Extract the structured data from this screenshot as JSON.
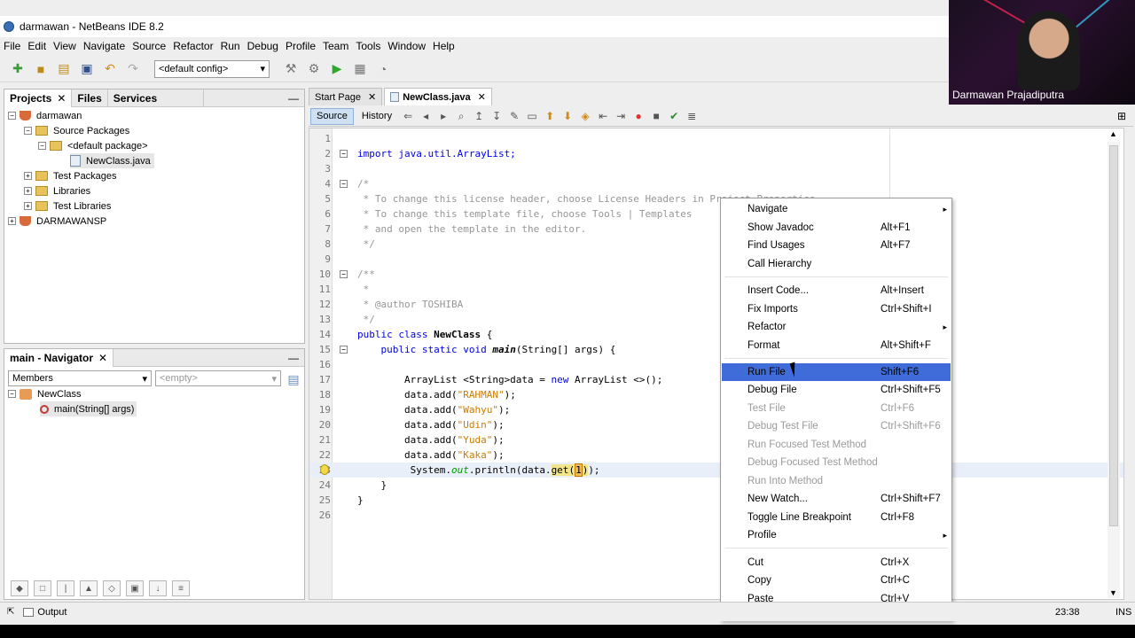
{
  "window": {
    "title": "darmawan - NetBeans IDE 8.2"
  },
  "menubar": [
    "File",
    "Edit",
    "View",
    "Navigate",
    "Source",
    "Refactor",
    "Run",
    "Debug",
    "Profile",
    "Team",
    "Tools",
    "Window",
    "Help"
  ],
  "toolbar": {
    "config": "<default config>"
  },
  "webcam": {
    "name": "Darmawan Prajadiputra"
  },
  "projects_panel": {
    "tabs": [
      "Projects",
      "Files",
      "Services"
    ],
    "tree": [
      {
        "label": "darmawan"
      },
      {
        "label": "Source Packages"
      },
      {
        "label": "<default package>"
      },
      {
        "label": "NewClass.java"
      },
      {
        "label": "Test Packages"
      },
      {
        "label": "Libraries"
      },
      {
        "label": "Test Libraries"
      },
      {
        "label": "DARMAWANSP"
      }
    ]
  },
  "navigator": {
    "title": "main - Navigator",
    "filter": "Members",
    "filter2": "<empty>",
    "class": "NewClass",
    "method": "main(String[] args)"
  },
  "editor": {
    "tabs": [
      "Start Page",
      "NewClass.java"
    ],
    "source_label": "Source",
    "history_label": "History",
    "line_numbers": [
      "1",
      "2",
      "3",
      "4",
      "5",
      "6",
      "7",
      "8",
      "9",
      "10",
      "11",
      "12",
      "13",
      "14",
      "15",
      "16",
      "17",
      "18",
      "19",
      "20",
      "21",
      "22",
      "23",
      "24",
      "25",
      "26"
    ],
    "lines": {
      "l2": "import java.util.ArrayList;",
      "l4": "/*",
      "l5": " * To change this license header, choose License Headers in Project Properties.",
      "l6": " * To change this template file, choose Tools | Templates",
      "l7": " * and open the template in the editor.",
      "l8": " */",
      "l10": "/**",
      "l11": " *",
      "l12": " * @author TOSHIBA",
      "l13": " */",
      "l14a": "public class ",
      "l14b": "NewClass",
      "l14c": " {",
      "l15a": "    public static void ",
      "l15b": "main",
      "l15c": "(String[] args) {",
      "l17a": "        ArrayList <String>data = ",
      "l17b": "new",
      "l17c": " ArrayList <>();",
      "l18a": "        data.add(",
      "l18b": "\"RAHMAN\"",
      "l18c": ");",
      "l19b": "\"Wahyu\"",
      "l20b": "\"Udin\"",
      "l21b": "\"Yuda\"",
      "l22b": "\"Kaka\"",
      "l23a": "         System.",
      "l23b": "out",
      "l23c": ".println(data.",
      "l23d": "get",
      "l23e": "(",
      "l23f": "1",
      "l23g": ")",
      "l23h": ");",
      "l24": "    }",
      "l25": "}"
    }
  },
  "context_menu": [
    {
      "label": "Navigate",
      "shortcut": "",
      "submenu": true,
      "disabled": false
    },
    {
      "label": "Show Javadoc",
      "shortcut": "Alt+F1",
      "disabled": false
    },
    {
      "label": "Find Usages",
      "shortcut": "Alt+F7",
      "disabled": false
    },
    {
      "label": "Call Hierarchy",
      "shortcut": "",
      "disabled": false
    },
    {
      "label": "Insert Code...",
      "shortcut": "Alt+Insert",
      "disabled": false
    },
    {
      "label": "Fix Imports",
      "shortcut": "Ctrl+Shift+I",
      "disabled": false
    },
    {
      "label": "Refactor",
      "shortcut": "",
      "submenu": true,
      "disabled": false
    },
    {
      "label": "Format",
      "shortcut": "Alt+Shift+F",
      "disabled": false
    },
    {
      "label": "Run File",
      "shortcut": "Shift+F6",
      "disabled": false,
      "active": true
    },
    {
      "label": "Debug File",
      "shortcut": "Ctrl+Shift+F5",
      "disabled": false
    },
    {
      "label": "Test File",
      "shortcut": "Ctrl+F6",
      "disabled": true
    },
    {
      "label": "Debug Test File",
      "shortcut": "Ctrl+Shift+F6",
      "disabled": true
    },
    {
      "label": "Run Focused Test Method",
      "shortcut": "",
      "disabled": true
    },
    {
      "label": "Debug Focused Test Method",
      "shortcut": "",
      "disabled": true
    },
    {
      "label": "Run Into Method",
      "shortcut": "",
      "disabled": true
    },
    {
      "label": "New Watch...",
      "shortcut": "Ctrl+Shift+F7",
      "disabled": false
    },
    {
      "label": "Toggle Line Breakpoint",
      "shortcut": "Ctrl+F8",
      "disabled": false
    },
    {
      "label": "Profile",
      "shortcut": "",
      "submenu": true,
      "disabled": false
    },
    {
      "label": "Cut",
      "shortcut": "Ctrl+X",
      "disabled": false
    },
    {
      "label": "Copy",
      "shortcut": "Ctrl+C",
      "disabled": false
    },
    {
      "label": "Paste",
      "shortcut": "Ctrl+V",
      "disabled": false
    }
  ],
  "statusbar": {
    "output": "Output",
    "position": "23:38",
    "mode": "INS"
  },
  "colors": {
    "accent": "#3f6cd9",
    "keyword": "#0000e6",
    "string": "#ce7b00",
    "comment": "#969696"
  }
}
